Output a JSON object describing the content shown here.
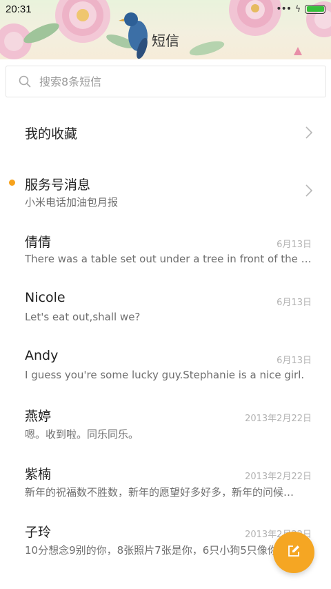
{
  "status_bar": {
    "time": "20:31",
    "battery_level": 1.0,
    "battery_color": "#35c03a"
  },
  "header": {
    "title": "短信"
  },
  "search": {
    "placeholder": "搜索8条短信",
    "icon": "search-icon"
  },
  "favorites": {
    "label": "我的收藏",
    "icon": "chevron-right-icon"
  },
  "service": {
    "title": "服务号消息",
    "subtitle": "小米电话加油包月报",
    "unread": true,
    "dot_color": "#f7a21b",
    "icon": "chevron-right-icon"
  },
  "conversations": [
    {
      "name": "倩倩",
      "date": "6月13日",
      "preview": "There was a table set out under a tree in front of the ho…"
    },
    {
      "name": "Nicole",
      "date": "6月13日",
      "preview": "Let's eat out,shall we?"
    },
    {
      "name": "Andy",
      "date": "6月13日",
      "preview": "I guess you're some lucky guy.Stephanie is a nice girl."
    },
    {
      "name": "燕婷",
      "date": "2013年2月22日",
      "preview": "嗯。收到啦。同乐同乐。"
    },
    {
      "name": "紫楠",
      "date": "2013年2月22日",
      "preview": "新年的祝福数不胜数，新年的愿望好多好多，新年的问候…"
    },
    {
      "name": "子玲",
      "date": "2013年2月22日",
      "preview": "10分想念9别的你，8张照片7张是你，6只小狗5只像你…"
    }
  ],
  "fab": {
    "icon": "compose-icon",
    "color": "#f5a623"
  }
}
